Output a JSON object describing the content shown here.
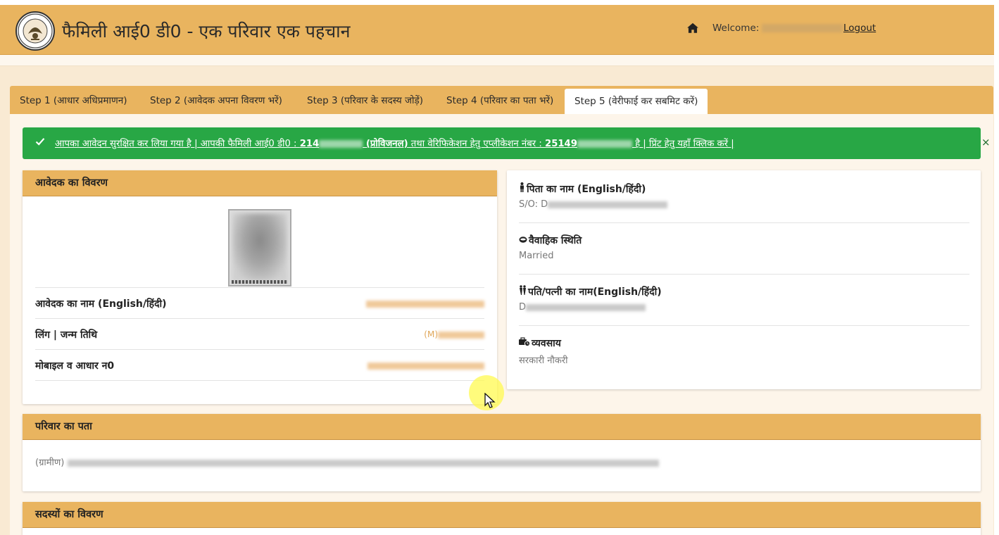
{
  "header": {
    "title": "फैमिली आई0 डी0 - एक परिवार एक पहचान",
    "welcome_label": "Welcome:",
    "logout_label": "Logout",
    "colors": {
      "header_bg": "#e9b45f",
      "page_bg": "#f9ead3"
    }
  },
  "tabs": [
    {
      "label": "Step 1 (आधार अधिप्रमाणन)"
    },
    {
      "label": "Step 2 (आवेदक अपना विवरण भरें)"
    },
    {
      "label": "Step 3 (परिवार के सदस्य जोड़ें)"
    },
    {
      "label": "Step 4 (परिवार का पता भरें)"
    },
    {
      "label": "Step 5 (वेरीफाई कर सबमिट करें)",
      "active": true
    }
  ],
  "alert": {
    "part1": "आपका आवेदन सुरक्षित कर लिया गया है | आपकी फैमिली आई0 डी0 : ",
    "family_id_prefix": "214",
    "part2": " (प्रोविजनल)",
    "part3": " तथा वेरिफिकेशन हेतु एप्लीकेशन नंबर : ",
    "app_no_prefix": "25149",
    "part4": " है | प्रिंट हेतु यहाँ क्लिक करें |",
    "close_label": "×",
    "color": "#28a745"
  },
  "applicant": {
    "heading": "आवेदक का विवरण",
    "rows": [
      {
        "label": "आवेदक का नाम (English/हिंदी)"
      },
      {
        "label": "लिंग | जन्म तिथि",
        "value_prefix": "(M)"
      },
      {
        "label": "मोबाइल व आधार न0"
      }
    ]
  },
  "details": {
    "father": {
      "title": "पिता का नाम (English/हिंदी)",
      "value_prefix": "S/O: D"
    },
    "marital": {
      "title": "वैवाहिक स्थिति",
      "value": "Married"
    },
    "spouse": {
      "title": "पति/पत्नी का नाम(English/हिंदी)",
      "value_prefix": "D"
    },
    "occupation": {
      "title": "व्यवसाय",
      "value": "सरकारी नौकरी"
    }
  },
  "family_address": {
    "heading": "परिवार का पता",
    "type": "(ग्रामीण)"
  },
  "members": {
    "heading": "सदस्यों का विवरण"
  }
}
